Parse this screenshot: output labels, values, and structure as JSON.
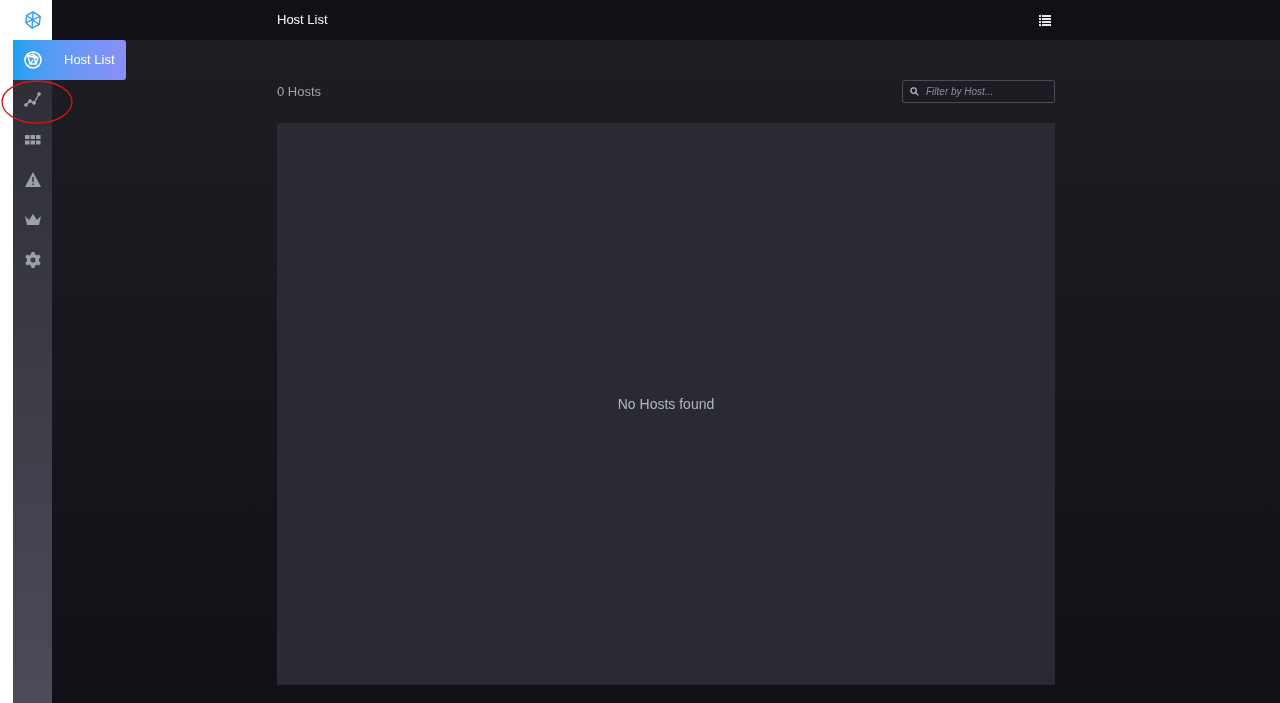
{
  "header": {
    "title": "Host List"
  },
  "sidebar": {
    "items": [
      {
        "kind": "globe",
        "selected": true,
        "label": "Host List"
      },
      {
        "kind": "graph",
        "selected": false
      },
      {
        "kind": "grid",
        "selected": false
      },
      {
        "kind": "alert",
        "selected": false
      },
      {
        "kind": "crown",
        "selected": false
      },
      {
        "kind": "gear",
        "selected": false
      }
    ]
  },
  "content": {
    "count": "0 Hosts",
    "filter": {
      "placeholder": "Filter by Host..."
    },
    "empty_message": "No Hosts found"
  }
}
